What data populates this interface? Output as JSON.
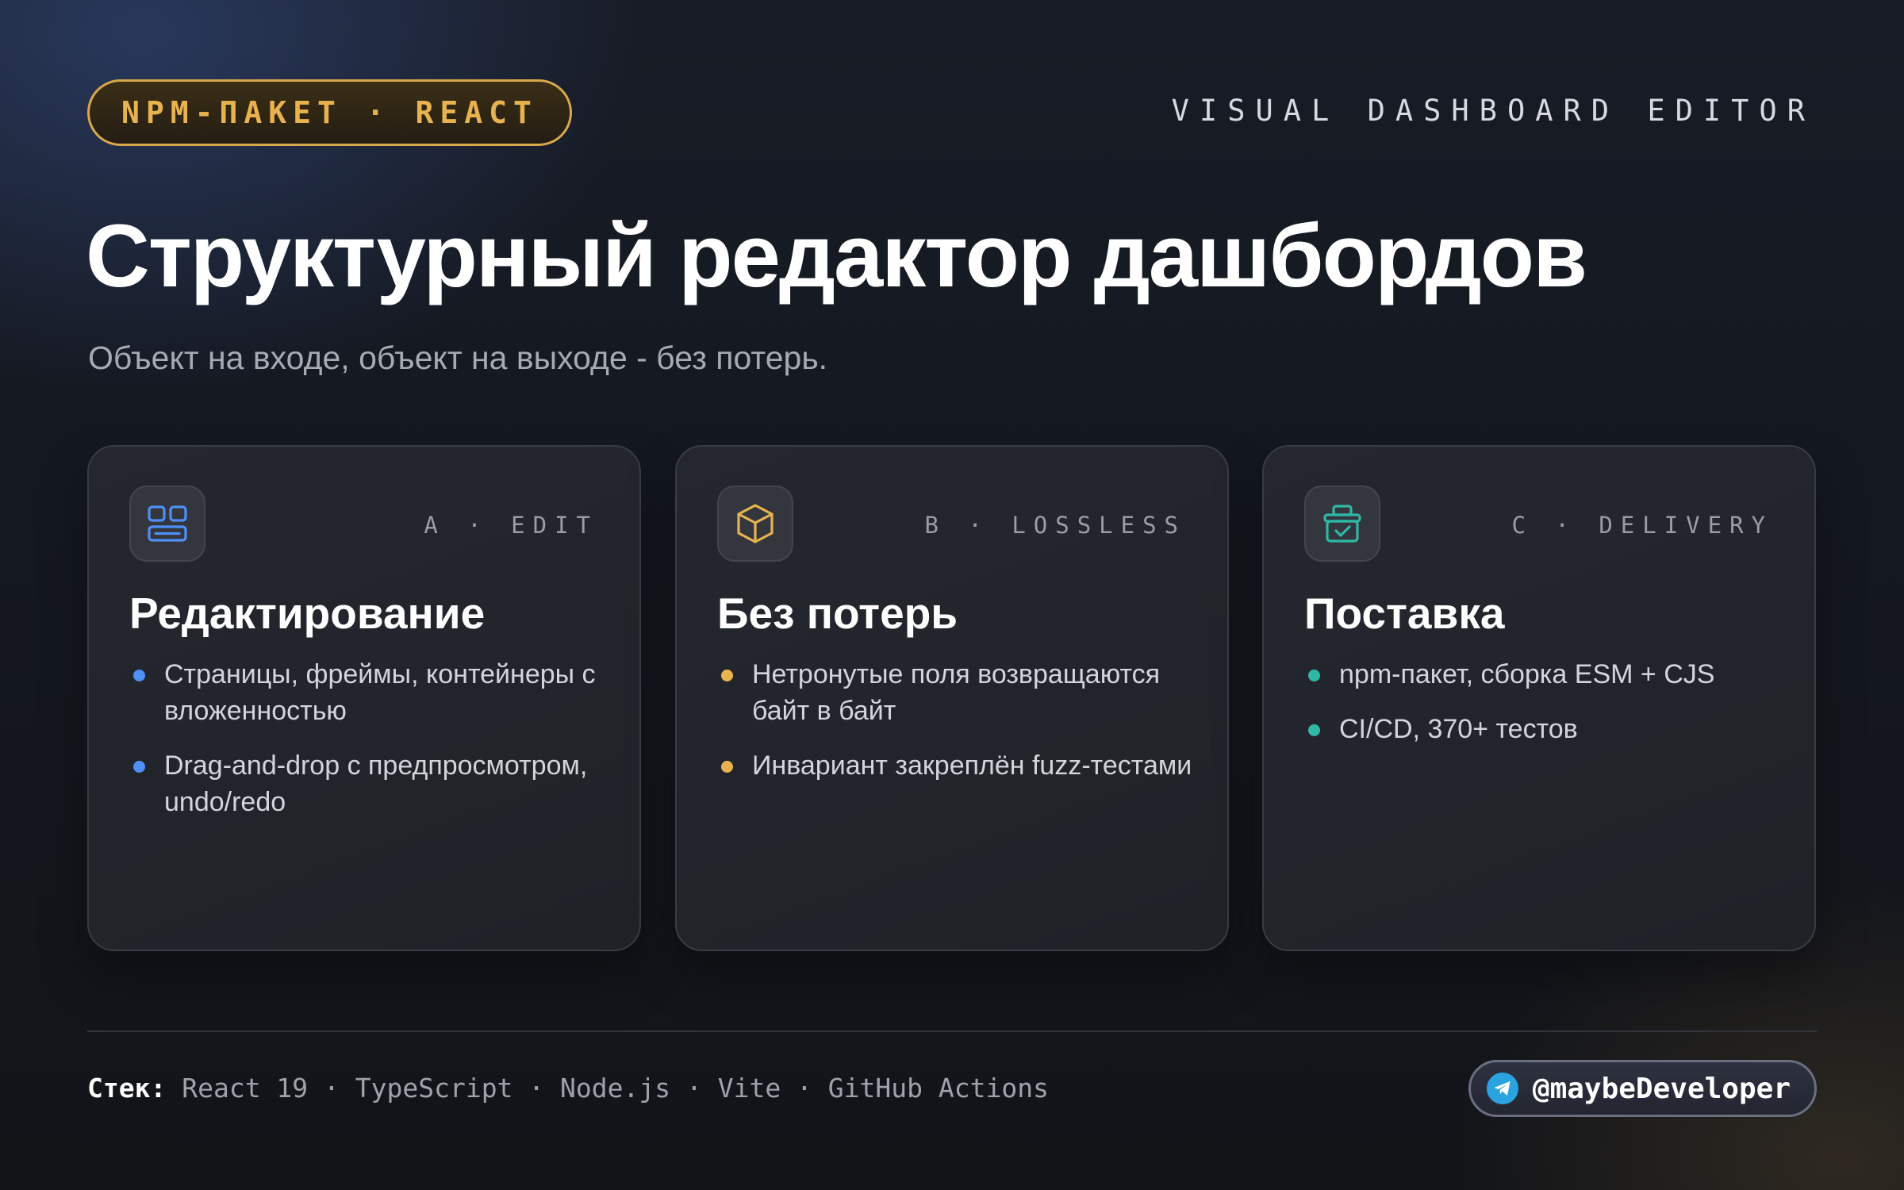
{
  "header": {
    "badge": "NPM-ПАКЕТ · REACT",
    "tagline": "VISUAL DASHBOARD EDITOR"
  },
  "hero": {
    "title": "Структурный редактор дашбордов",
    "subtitle": "Объект на входе, объект на выходе - без потерь."
  },
  "cards": [
    {
      "tag": "A · EDIT",
      "title": "Редактирование",
      "icon": "layout-icon",
      "accent": "#4f8ff7",
      "items": [
        "Страницы, фреймы, контейнеры с вложенностью",
        "Drag-and-drop с предпросмотром, undo/redo"
      ]
    },
    {
      "tag": "B · LOSSLESS",
      "title": "Без потерь",
      "icon": "cube-icon",
      "accent": "#e8b34f",
      "items": [
        "Нетронутые поля возвращаются байт в байт",
        "Инвариант закреплён fuzz-тестами"
      ]
    },
    {
      "tag": "C · DELIVERY",
      "title": "Поставка",
      "icon": "package-check-icon",
      "accent": "#2fb8a6",
      "items": [
        "npm-пакет, сборка ESM + CJS",
        "CI/CD, 370+ тестов"
      ]
    }
  ],
  "footer": {
    "stack_label": "Стек:",
    "stack_items": "React 19 · TypeScript · Node.js · Vite · GitHub Actions",
    "handle": "@maybeDeveloper",
    "handle_icon": "telegram-icon"
  }
}
